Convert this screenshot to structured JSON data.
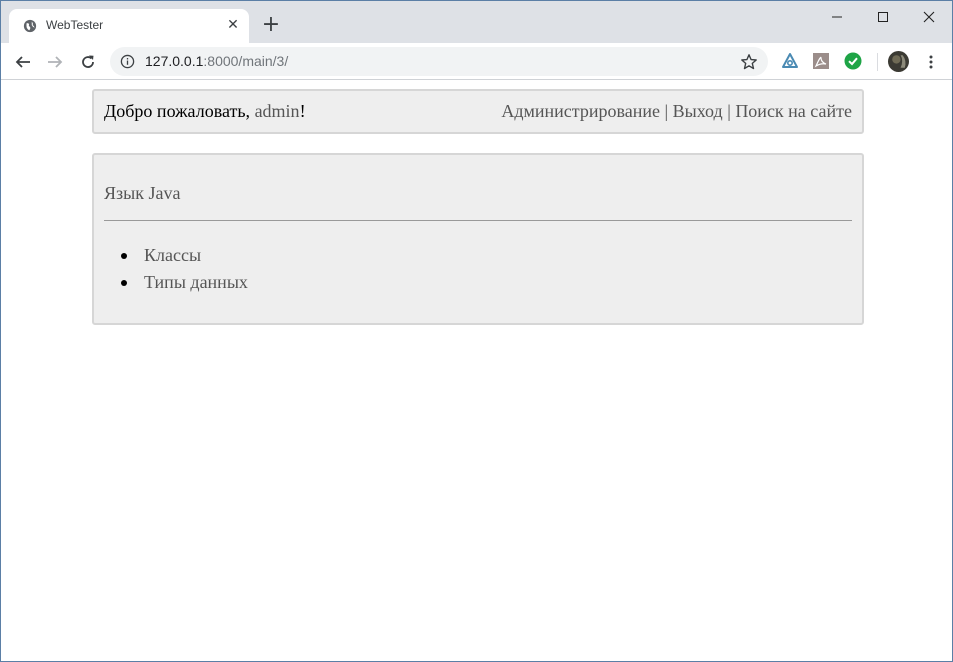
{
  "browser": {
    "tab": {
      "title": "WebTester",
      "close_glyph": "✕",
      "favicon": "globe-icon"
    },
    "new_tab_glyph": "+",
    "address": {
      "host": "127.0.0.1",
      "rest": ":8000/main/3/"
    },
    "extensions": [
      "cyrillic-a-extension-icon",
      "pdf-extension-icon",
      "green-check-extension-icon",
      "profile-avatar"
    ],
    "accent": "#dee1e6"
  },
  "header": {
    "welcome_prefix": "Добро пожаловать, ",
    "username": "admin",
    "welcome_suffix": "!",
    "links": [
      {
        "label": "Администрирование"
      },
      {
        "label": "Выход"
      },
      {
        "label": "Поиск на сайте"
      }
    ],
    "separator": " | "
  },
  "content": {
    "title": "Язык Java",
    "items": [
      {
        "label": "Классы"
      },
      {
        "label": "Типы данных"
      }
    ]
  }
}
